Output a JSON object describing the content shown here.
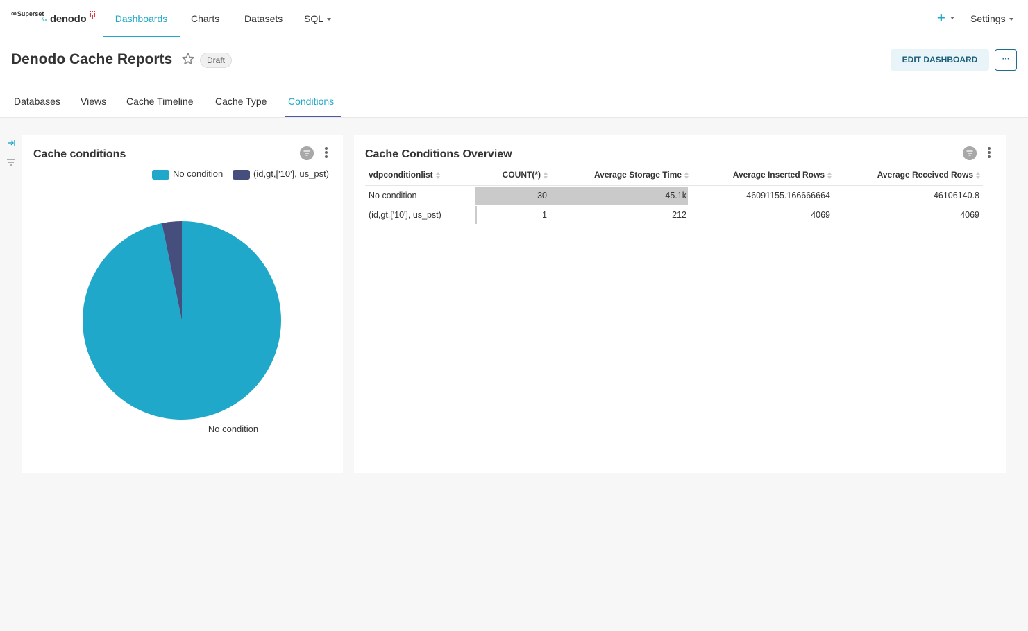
{
  "app": {
    "logo_superset": "Superset",
    "logo_for": "for",
    "logo_denodo": "denodo"
  },
  "nav": {
    "items": [
      {
        "label": "Dashboards",
        "active": true
      },
      {
        "label": "Charts",
        "active": false
      },
      {
        "label": "Datasets",
        "active": false
      },
      {
        "label": "SQL",
        "active": false
      }
    ],
    "settings_label": "Settings",
    "plus_label": "+"
  },
  "header": {
    "title": "Denodo Cache Reports",
    "badge": "Draft",
    "edit_label": "EDIT DASHBOARD",
    "more_label": "···"
  },
  "tabs": [
    {
      "label": "Databases",
      "active": false
    },
    {
      "label": "Views",
      "active": false
    },
    {
      "label": "Cache Timeline",
      "active": false
    },
    {
      "label": "Cache Type",
      "active": false
    },
    {
      "label": "Conditions",
      "active": true
    }
  ],
  "pie_panel": {
    "title": "Cache conditions",
    "chart_data": {
      "type": "pie",
      "slices": [
        {
          "label": "No condition",
          "value": 30,
          "color": "#1fa8c9"
        },
        {
          "label": "(id,gt,['10'], us_pst)",
          "value": 1,
          "color": "#454e7c"
        }
      ],
      "legend": [
        "No condition",
        "(id,gt,['10'], us_pst)"
      ],
      "legend_position": "top-right",
      "slice_labels": [
        "No condition"
      ]
    }
  },
  "table_panel": {
    "title": "Cache Conditions Overview",
    "columns": [
      "vdpconditionlist",
      "COUNT(*)",
      "Average Storage Time",
      "Average Inserted Rows",
      "Average Received Rows"
    ],
    "rows": [
      [
        "No condition",
        "30",
        "45.1k",
        "46091155.166666664",
        "46106140.8"
      ],
      [
        "(id,gt,['10'], us_pst)",
        "1",
        "212",
        "4069",
        "4069"
      ]
    ],
    "count_bar_fraction": [
      1.0,
      0.033
    ],
    "storage_bar_fraction": [
      1.0,
      0.0047
    ]
  },
  "colors": {
    "accent": "#1fa8c9",
    "secondary": "#454e7c",
    "bar": "#cacaca"
  }
}
